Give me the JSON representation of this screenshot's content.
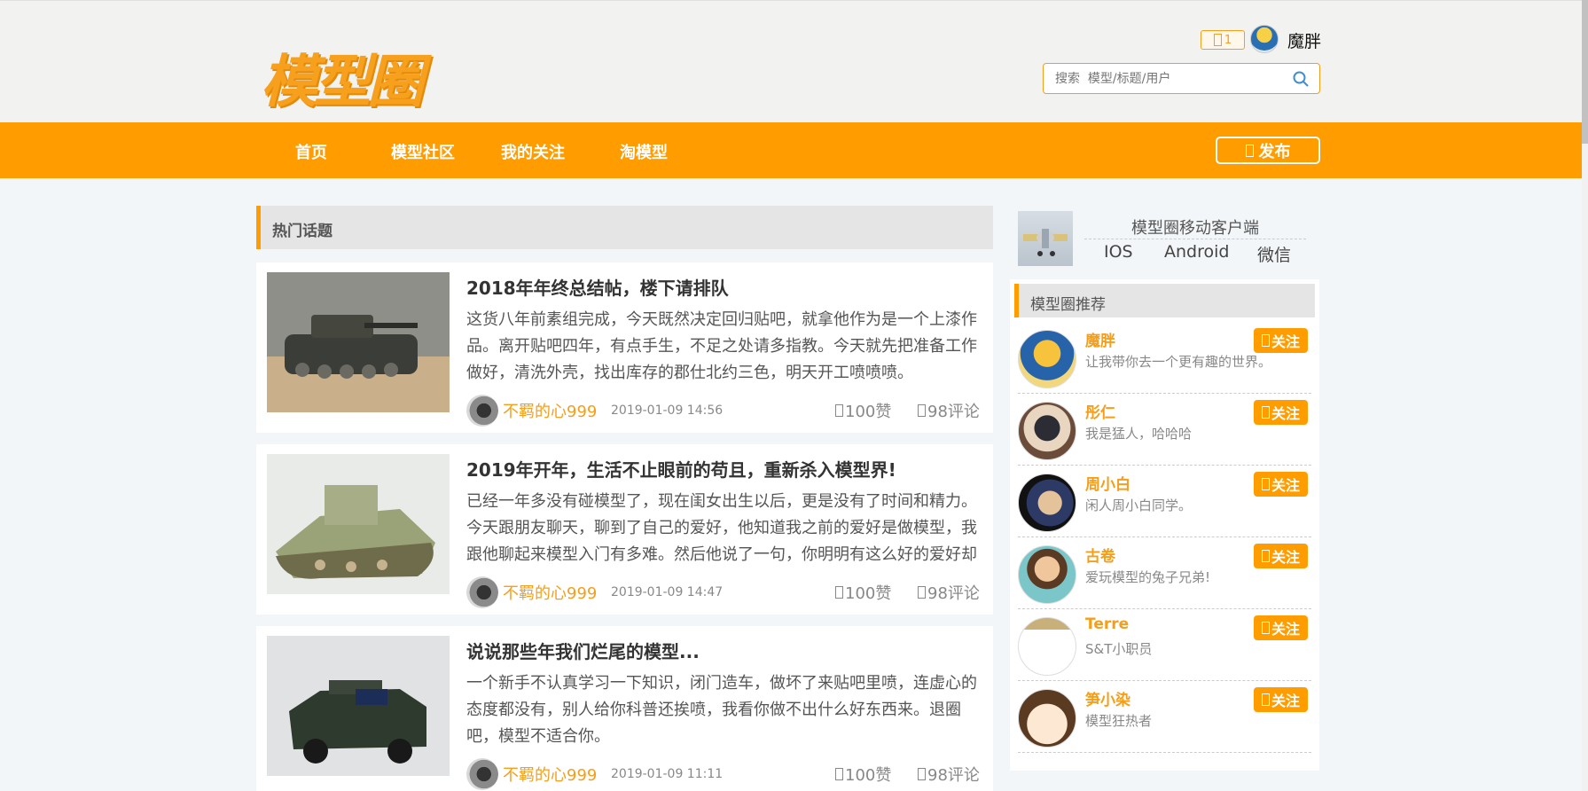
{
  "header": {
    "logo": "模型圈",
    "message_count": "1",
    "username": "魔胖",
    "search_placeholder": "搜索  模型/标题/用户"
  },
  "nav": {
    "items": [
      "首页",
      "模型社区",
      "我的关注",
      "淘模型"
    ],
    "publish_label": "发布"
  },
  "main": {
    "section_title": "热门话题",
    "posts": [
      {
        "title": "2018年年终总结帖，楼下请排队",
        "body": "这货八年前素组完成，今天既然决定回归贴吧，就拿他作为是一个上漆作品。离开贴吧四年，有点手生，不足之处请多指教。今天就先把准备工作做好，清洗外壳，找出库存的郡仕北约三色，明天开工喷喷喷。",
        "author": "不羁的心999",
        "time": "2019-01-09 14:56",
        "likes": "100赞",
        "comments": "98评论"
      },
      {
        "title": "2019年开年，生活不止眼前的苟且，重新杀入模型界!",
        "body": "已经一年多没有碰模型了，现在闺女出生以后，更是没有了时间和精力。今天跟朋友聊天，聊到了自己的爱好，他知道我之前的爱好是做模型，我跟他聊起来模型入门有多难。然后他说了一句，你明明有这么好的爱好却放弃",
        "author": "不羁的心999",
        "time": "2019-01-09 14:47",
        "likes": "100赞",
        "comments": "98评论"
      },
      {
        "title": "说说那些年我们烂尾的模型...",
        "body": "一个新手不认真学习一下知识，闭门造车，做坏了来贴吧里喷，连虚心的态度都没有，别人给你科普还挨喷，我看你做不出什么好东西来。退圈吧，模型不适合你。",
        "author": "不羁的心999",
        "time": "2019-01-09 11:11",
        "likes": "100赞",
        "comments": "98评论"
      }
    ]
  },
  "sidebar": {
    "app_title": "模型圈移动客户端",
    "app_links": [
      "IOS",
      "Android",
      "微信"
    ],
    "rec_title": "模型圈推荐",
    "follow_label": "关注",
    "recommendations": [
      {
        "name": "魔胖",
        "desc": "让我带你去一个更有趣的世界。"
      },
      {
        "name": "彤仁",
        "desc": "我是猛人，哈哈哈"
      },
      {
        "name": "周小白",
        "desc": "闲人周小白同学。"
      },
      {
        "name": "古卷",
        "desc": "爱玩模型的兔子兄弟!"
      },
      {
        "name": "Terre",
        "desc": "S&T小职员"
      },
      {
        "name": "笋小染",
        "desc": "模型狂热者"
      }
    ]
  },
  "colors": {
    "accent": "#ff9c00",
    "accent_text": "#f59e1b"
  }
}
